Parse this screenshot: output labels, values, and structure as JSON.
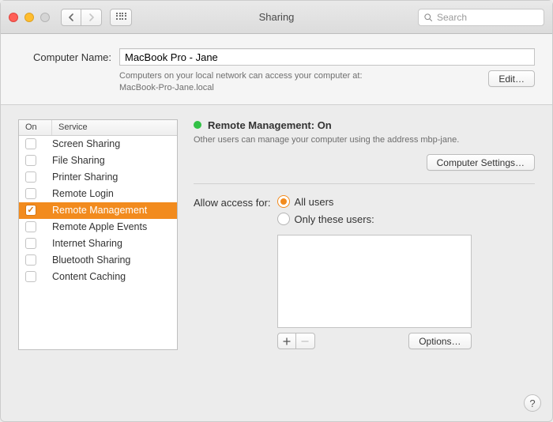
{
  "window": {
    "title": "Sharing",
    "search_placeholder": "Search"
  },
  "computer_name": {
    "label": "Computer Name:",
    "value": "MacBook Pro - Jane",
    "caption_line1": "Computers on your local network can access your computer at:",
    "caption_line2": "MacBook-Pro-Jane.local",
    "edit_label": "Edit…"
  },
  "service_table": {
    "col_on": "On",
    "col_service": "Service",
    "rows": [
      {
        "label": "Screen Sharing",
        "checked": false,
        "selected": false
      },
      {
        "label": "File Sharing",
        "checked": false,
        "selected": false
      },
      {
        "label": "Printer Sharing",
        "checked": false,
        "selected": false
      },
      {
        "label": "Remote Login",
        "checked": false,
        "selected": false
      },
      {
        "label": "Remote Management",
        "checked": true,
        "selected": true
      },
      {
        "label": "Remote Apple Events",
        "checked": false,
        "selected": false
      },
      {
        "label": "Internet Sharing",
        "checked": false,
        "selected": false
      },
      {
        "label": "Bluetooth Sharing",
        "checked": false,
        "selected": false
      },
      {
        "label": "Content Caching",
        "checked": false,
        "selected": false
      }
    ]
  },
  "detail": {
    "status_title": "Remote Management: On",
    "status_color": "#32c146",
    "status_desc": "Other users can manage your computer using the address mbp-jane.",
    "computer_settings_label": "Computer Settings…",
    "access_label": "Allow access for:",
    "radio_all": "All users",
    "radio_only": "Only these users:",
    "selected_radio": "all",
    "add_label": "+",
    "remove_label": "−",
    "options_label": "Options…"
  },
  "help_label": "?"
}
